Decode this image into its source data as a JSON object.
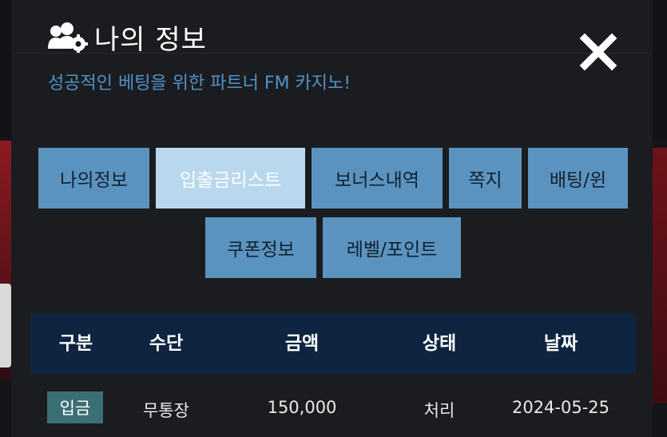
{
  "modal": {
    "title": "나의 정보",
    "subtitle": "성공적인 베팅을 위한 파트너 FM 카지노!",
    "title_icon": "users-gear-icon",
    "close_icon": "close-icon"
  },
  "tabs": [
    {
      "label": "나의정보",
      "active": false
    },
    {
      "label": "입출금리스트",
      "active": true
    },
    {
      "label": "보너스내역",
      "active": false
    },
    {
      "label": "쪽지",
      "active": false
    },
    {
      "label": "배팅/윈",
      "active": false
    },
    {
      "label": "쿠폰정보",
      "active": false
    },
    {
      "label": "레벨/포인트",
      "active": false
    }
  ],
  "table": {
    "headers": [
      "구분",
      "수단",
      "금액",
      "상태",
      "날짜"
    ],
    "rows": [
      {
        "type": "입금",
        "method": "무통장",
        "amount": "150,000",
        "status": "처리",
        "date": "2024-05-25"
      }
    ]
  },
  "colors": {
    "accent": "#5b93c0",
    "active_tab": "#b9d8ee",
    "header_bg": "#0f2440",
    "badge": "#3a6f74",
    "subtitle": "#4f93c9"
  }
}
